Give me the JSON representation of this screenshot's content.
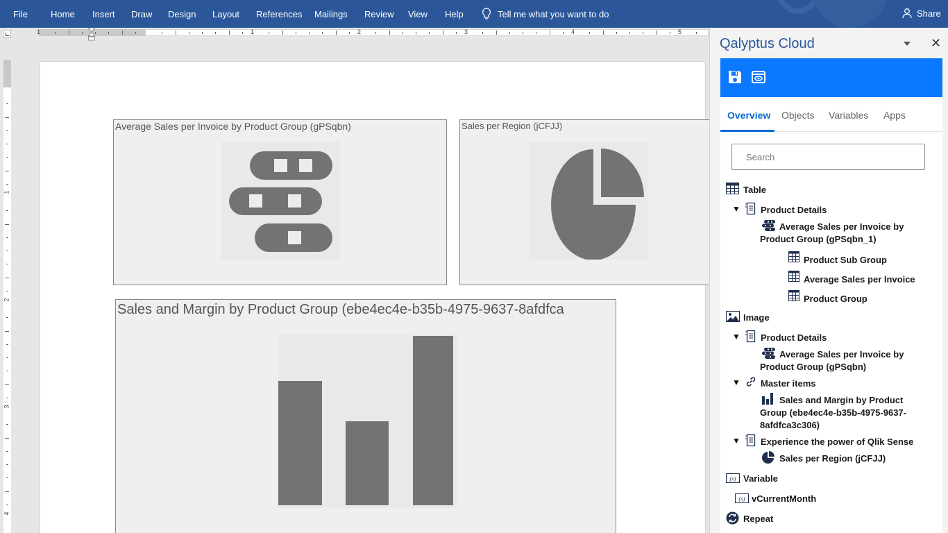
{
  "ribbon": {
    "menu": [
      "File",
      "Home",
      "Insert",
      "Draw",
      "Design",
      "Layout",
      "References",
      "Mailings",
      "Review",
      "View",
      "Help"
    ],
    "tell_me": "Tell me what you want to do",
    "share": "Share"
  },
  "ruler": {
    "h_numbers": [
      "1",
      "1",
      "2",
      "3",
      "4",
      "5"
    ],
    "v_numbers": [
      "1",
      "2",
      "3",
      "4"
    ]
  },
  "document": {
    "objects": [
      {
        "title": "Average Sales per Invoice by Product Group (gPSqbn)",
        "icon": "table-rows-icon"
      },
      {
        "title": "Sales per Region (jCFJJ)",
        "icon": "pie-chart-icon"
      },
      {
        "title": "Sales and Margin by Product Group (ebe4ec4e-b35b-4975-9637-8afdfca",
        "icon": "bar-chart-icon"
      }
    ]
  },
  "pane": {
    "title": "Qalyptus Cloud",
    "toolbar": {
      "save_icon": "save-icon",
      "preview_icon": "preview-icon"
    },
    "tabs": [
      "Overview",
      "Objects",
      "Variables",
      "Apps"
    ],
    "active_tab": "Overview",
    "search_placeholder": "Search",
    "tree": {
      "table": {
        "label": "Table",
        "product_details": "Product Details",
        "avg_sales_line1": "Average Sales per Invoice by",
        "avg_sales_line2": "Product Group (gPSqbn_1)",
        "fields": [
          "Product Sub Group",
          "Average Sales per Invoice",
          "Product Group"
        ]
      },
      "image": {
        "label": "Image",
        "product_details": "Product Details",
        "avg_sales_line1": "Average Sales per Invoice by",
        "avg_sales_line2": "Product Group (gPSqbn)",
        "master_items": "Master items",
        "sales_margin_line1": "Sales and Margin by Product",
        "sales_margin_line2": "Group (ebe4ec4e-b35b-4975-9637-",
        "sales_margin_line3": "8afdfca3c306)",
        "experience": "Experience the power of Qlik Sense",
        "sales_region": "Sales per Region (jCFJJ)"
      },
      "variable": {
        "label": "Variable",
        "item": "vCurrentMonth"
      },
      "repeat": {
        "label": "Repeat"
      }
    }
  },
  "colors": {
    "ribbon": "#2b579a",
    "toolbar": "#0a78ff",
    "accent": "#0a6bd6",
    "icon_gray": "#737373",
    "tree_icon": "#1f2f4d"
  }
}
